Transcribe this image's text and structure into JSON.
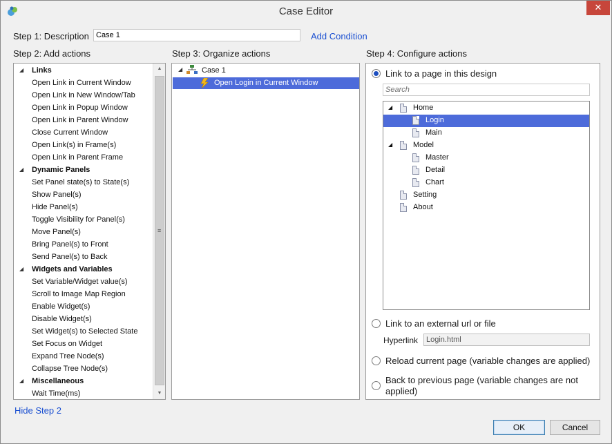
{
  "window": {
    "title": "Case Editor",
    "close_label": "✕"
  },
  "step1": {
    "label": "Step 1: Description",
    "description_value": "Case 1",
    "add_condition_label": "Add Condition"
  },
  "step2": {
    "label": "Step 2: Add actions",
    "rows": [
      {
        "text": "Links",
        "kind": "category"
      },
      {
        "text": "Open Link in Current Window",
        "kind": "item"
      },
      {
        "text": "Open Link in New Window/Tab",
        "kind": "item"
      },
      {
        "text": "Open Link in Popup Window",
        "kind": "item"
      },
      {
        "text": "Open Link in Parent Window",
        "kind": "item"
      },
      {
        "text": "Close Current Window",
        "kind": "item"
      },
      {
        "text": "Open Link(s) in Frame(s)",
        "kind": "item"
      },
      {
        "text": "Open Link in Parent Frame",
        "kind": "item"
      },
      {
        "text": "Dynamic Panels",
        "kind": "category"
      },
      {
        "text": "Set Panel state(s) to State(s)",
        "kind": "item"
      },
      {
        "text": "Show Panel(s)",
        "kind": "item"
      },
      {
        "text": "Hide Panel(s)",
        "kind": "item"
      },
      {
        "text": "Toggle Visibility for Panel(s)",
        "kind": "item"
      },
      {
        "text": "Move Panel(s)",
        "kind": "item"
      },
      {
        "text": "Bring Panel(s) to Front",
        "kind": "item"
      },
      {
        "text": "Send Panel(s) to Back",
        "kind": "item"
      },
      {
        "text": "Widgets and Variables",
        "kind": "category"
      },
      {
        "text": "Set Variable/Widget value(s)",
        "kind": "item"
      },
      {
        "text": "Scroll to Image Map Region",
        "kind": "item"
      },
      {
        "text": "Enable Widget(s)",
        "kind": "item"
      },
      {
        "text": "Disable Widget(s)",
        "kind": "item"
      },
      {
        "text": "Set Widget(s) to Selected State",
        "kind": "item"
      },
      {
        "text": "Set Focus on Widget",
        "kind": "item"
      },
      {
        "text": "Expand Tree Node(s)",
        "kind": "item"
      },
      {
        "text": "Collapse Tree Node(s)",
        "kind": "item"
      },
      {
        "text": "Miscellaneous",
        "kind": "category"
      },
      {
        "text": "Wait Time(ms)",
        "kind": "item"
      }
    ]
  },
  "step3": {
    "label": "Step 3: Organize actions",
    "case_name": "Case 1",
    "action": "Open Login in Current Window"
  },
  "step4": {
    "label": "Step 4: Configure actions",
    "option_page": "Link to a page in this design",
    "search_placeholder": "Search",
    "tree": [
      {
        "text": "Home",
        "level": 0,
        "expandable": true
      },
      {
        "text": "Login",
        "level": 1,
        "selected": true
      },
      {
        "text": "Main",
        "level": 1
      },
      {
        "text": "Model",
        "level": 0,
        "expandable": true
      },
      {
        "text": "Master",
        "level": 1
      },
      {
        "text": "Detail",
        "level": 1
      },
      {
        "text": "Chart",
        "level": 1
      },
      {
        "text": "Setting",
        "level": 0
      },
      {
        "text": "About",
        "level": 0
      }
    ],
    "option_external": "Link to an external url or file",
    "hyperlink_label": "Hyperlink",
    "hyperlink_value": "Login.html",
    "option_reload": "Reload current page (variable changes are applied)",
    "option_back_line1": "Back to previous page (variable changes are not",
    "option_back_line2": "applied)"
  },
  "footer": {
    "hide_step2": "Hide Step 2",
    "ok": "OK",
    "cancel": "Cancel"
  },
  "colors": {
    "accent": "#4d6bda",
    "link": "#1a4fd1",
    "close": "#c7463b"
  }
}
